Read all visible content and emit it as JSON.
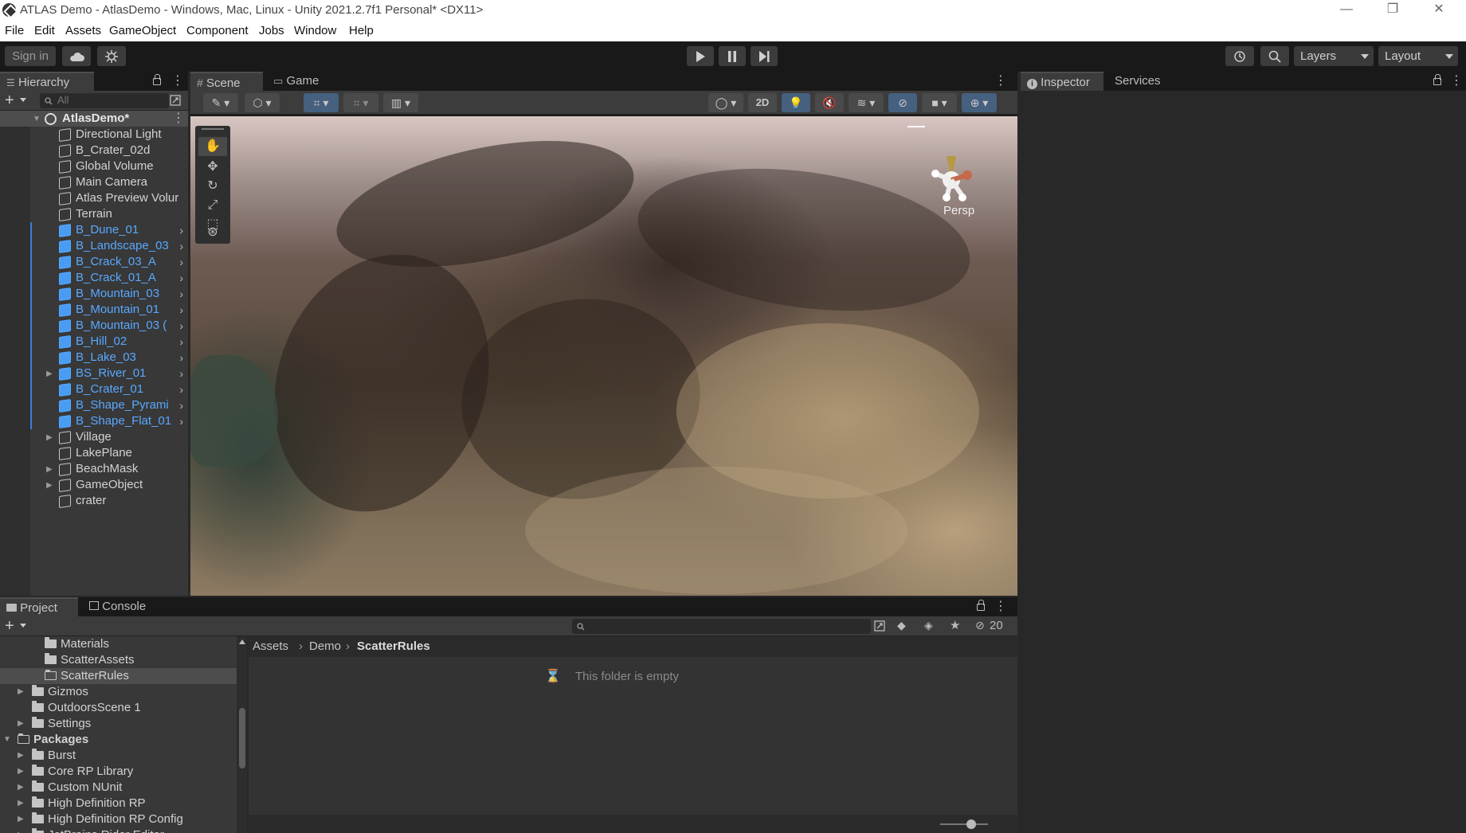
{
  "window": {
    "title": "ATLAS Demo - AtlasDemo - Windows, Mac, Linux - Unity 2021.2.7f1 Personal* <DX11>",
    "minimize": "—",
    "restore": "❐",
    "close": "✕"
  },
  "menu": [
    "File",
    "Edit",
    "Assets",
    "GameObject",
    "Component",
    "Jobs",
    "Window",
    "Help"
  ],
  "toolbar": {
    "sign_in": "Sign in",
    "layers": "Layers",
    "layout": "Layout"
  },
  "hierarchy": {
    "tab": "Hierarchy",
    "search_placeholder": "All",
    "scene_name": "AtlasDemo*",
    "items": [
      {
        "label": "Directional Light",
        "prefab": false,
        "expandable": false,
        "arrow": false
      },
      {
        "label": "B_Crater_02d",
        "prefab": false,
        "expandable": false,
        "arrow": false
      },
      {
        "label": "Global Volume",
        "prefab": false,
        "expandable": false,
        "arrow": false
      },
      {
        "label": "Main Camera",
        "prefab": false,
        "expandable": false,
        "arrow": false
      },
      {
        "label": "Atlas Preview Volur",
        "prefab": false,
        "expandable": false,
        "arrow": false
      },
      {
        "label": "Terrain",
        "prefab": false,
        "expandable": false,
        "arrow": false
      },
      {
        "label": "B_Dune_01",
        "prefab": true,
        "expandable": false,
        "arrow": true
      },
      {
        "label": "B_Landscape_03",
        "prefab": true,
        "expandable": false,
        "arrow": true
      },
      {
        "label": "B_Crack_03_A",
        "prefab": true,
        "expandable": false,
        "arrow": true
      },
      {
        "label": "B_Crack_01_A",
        "prefab": true,
        "expandable": false,
        "arrow": true
      },
      {
        "label": "B_Mountain_03",
        "prefab": true,
        "expandable": false,
        "arrow": true
      },
      {
        "label": "B_Mountain_01",
        "prefab": true,
        "expandable": false,
        "arrow": true
      },
      {
        "label": "B_Mountain_03 (",
        "prefab": true,
        "expandable": false,
        "arrow": true
      },
      {
        "label": "B_Hill_02",
        "prefab": true,
        "expandable": false,
        "arrow": true
      },
      {
        "label": "B_Lake_03",
        "prefab": true,
        "expandable": false,
        "arrow": true
      },
      {
        "label": "BS_River_01",
        "prefab": true,
        "expandable": true,
        "arrow": true
      },
      {
        "label": "B_Crater_01",
        "prefab": true,
        "expandable": false,
        "arrow": true
      },
      {
        "label": "B_Shape_Pyrami",
        "prefab": true,
        "expandable": false,
        "arrow": true
      },
      {
        "label": "B_Shape_Flat_01",
        "prefab": true,
        "expandable": false,
        "arrow": true
      },
      {
        "label": "Village",
        "prefab": false,
        "expandable": true,
        "arrow": false
      },
      {
        "label": "LakePlane",
        "prefab": false,
        "expandable": false,
        "arrow": false
      },
      {
        "label": "BeachMask",
        "prefab": false,
        "expandable": true,
        "arrow": false
      },
      {
        "label": "GameObject",
        "prefab": false,
        "expandable": true,
        "arrow": false
      },
      {
        "label": "crater",
        "prefab": false,
        "expandable": false,
        "arrow": false
      }
    ]
  },
  "scene": {
    "tab_scene": "Scene",
    "tab_game": "Game",
    "mode_2d": "2D",
    "camera_label": "Persp"
  },
  "inspector": {
    "tab_inspector": "Inspector",
    "tab_services": "Services"
  },
  "project": {
    "tab_project": "Project",
    "tab_console": "Console",
    "hidden_count": "20",
    "breadcrumb": [
      "Assets",
      "Demo",
      "ScatterRules"
    ],
    "empty_message": "This folder is empty",
    "tree": [
      {
        "label": "Materials",
        "level": 2,
        "open": false,
        "selected": false,
        "fold": false
      },
      {
        "label": "ScatterAssets",
        "level": 2,
        "open": false,
        "selected": false,
        "fold": false
      },
      {
        "label": "ScatterRules",
        "level": 2,
        "open": true,
        "selected": true,
        "fold": false
      },
      {
        "label": "Gizmos",
        "level": 1,
        "open": false,
        "selected": false,
        "fold": true
      },
      {
        "label": "OutdoorsScene 1",
        "level": 1,
        "open": false,
        "selected": false,
        "fold": false
      },
      {
        "label": "Settings",
        "level": 1,
        "open": false,
        "selected": false,
        "fold": true
      },
      {
        "label": "Packages",
        "level": 0,
        "open": true,
        "selected": false,
        "fold": true,
        "bold": true
      },
      {
        "label": "Burst",
        "level": 1,
        "open": false,
        "selected": false,
        "fold": true
      },
      {
        "label": "Core RP Library",
        "level": 1,
        "open": false,
        "selected": false,
        "fold": true
      },
      {
        "label": "Custom NUnit",
        "level": 1,
        "open": false,
        "selected": false,
        "fold": true
      },
      {
        "label": "High Definition RP",
        "level": 1,
        "open": false,
        "selected": false,
        "fold": true
      },
      {
        "label": "High Definition RP Config",
        "level": 1,
        "open": false,
        "selected": false,
        "fold": true
      },
      {
        "label": "JetBrains Rider Editor",
        "level": 1,
        "open": false,
        "selected": false,
        "fold": true
      }
    ]
  },
  "colors": {
    "prefab_blue": "#59a8ff",
    "selection": "#4d4d4d",
    "toolbar_bg": "#191919",
    "panel_bg": "#282828"
  }
}
